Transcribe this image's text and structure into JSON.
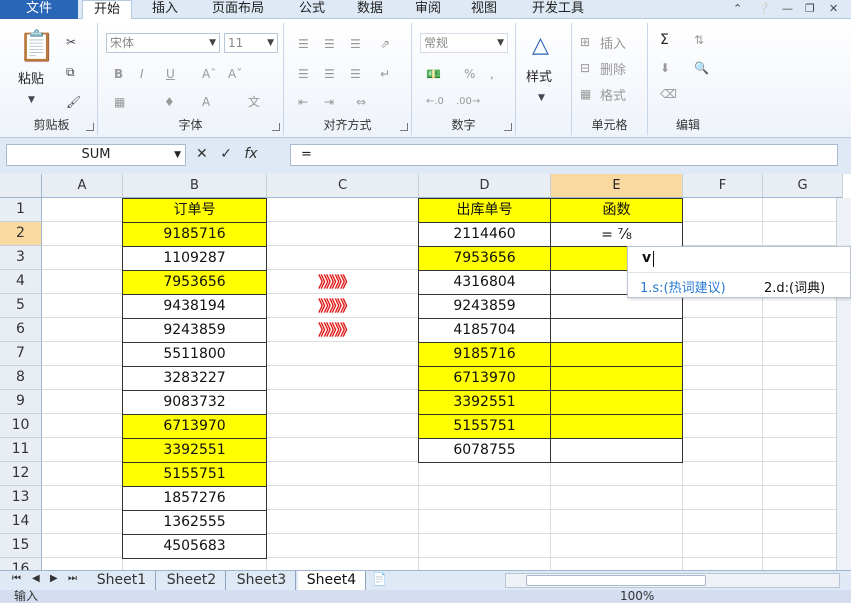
{
  "ribbon_tabs": [
    "文件",
    "开始",
    "插入",
    "页面布局",
    "公式",
    "数据",
    "审阅",
    "视图",
    "开发工具"
  ],
  "active_tab": "开始",
  "clipboard": {
    "paste": "粘贴",
    "label": "剪贴板"
  },
  "font": {
    "name": "宋体",
    "size": "11",
    "label": "字体",
    "bold": "B",
    "italic": "I",
    "underline": "U"
  },
  "alignment": {
    "label": "对齐方式"
  },
  "number": {
    "format": "常规",
    "label": "数字"
  },
  "styles": {
    "button": "样式"
  },
  "cells_group": {
    "insert": "插入",
    "delete": "删除",
    "format": "格式",
    "label": "单元格"
  },
  "editing": {
    "label": "编辑"
  },
  "formula_bar": {
    "name_box": "SUM",
    "formula": "="
  },
  "columns": [
    "A",
    "B",
    "C",
    "D",
    "E",
    "F",
    "G"
  ],
  "rows": [
    "1",
    "2",
    "3",
    "4",
    "5",
    "6",
    "7",
    "8",
    "9",
    "10",
    "11",
    "12",
    "13",
    "14",
    "15",
    "16"
  ],
  "col_b": {
    "header": "订单号",
    "values": [
      "9185716",
      "1109287",
      "7953656",
      "9438194",
      "9243859",
      "5511800",
      "3283227",
      "9083732",
      "6713970",
      "3392551",
      "5155751",
      "1857276",
      "1362555",
      "4505683"
    ]
  },
  "col_d": {
    "header": "出库单号",
    "values": [
      "2114460",
      "7953656",
      "4316804",
      "9243859",
      "4185704",
      "9185716",
      "6713970",
      "3392551",
      "5155751",
      "6078755"
    ]
  },
  "col_e": {
    "header": "函数",
    "active_value": "= "
  },
  "arrow_text": "》》》》》",
  "ime": {
    "typed": "v",
    "candidate_1": "1.s:(热词建议)",
    "candidate_2": "2.d:(词典)"
  },
  "sheets": [
    "Sheet1",
    "Sheet2",
    "Sheet3",
    "Sheet4"
  ],
  "active_sheet": "Sheet4",
  "status": {
    "mode": "输入",
    "zoom": "100%"
  }
}
